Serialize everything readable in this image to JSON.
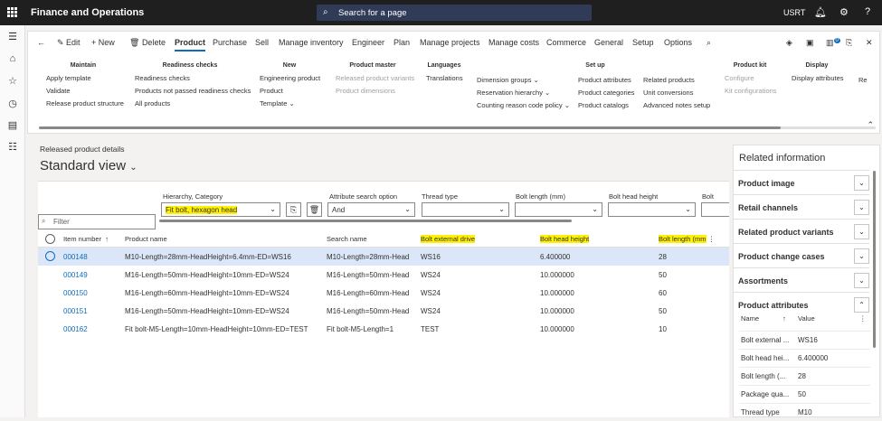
{
  "topbar": {
    "app_title": "Finance and Operations",
    "search_placeholder": "Search for a page",
    "company": "USRT"
  },
  "tabs": [
    {
      "label": "Edit"
    },
    {
      "label": "New"
    },
    {
      "label": "Delete"
    },
    {
      "label": "Product"
    },
    {
      "label": "Purchase"
    },
    {
      "label": "Sell"
    },
    {
      "label": "Manage inventory"
    },
    {
      "label": "Engineer"
    },
    {
      "label": "Plan"
    },
    {
      "label": "Manage projects"
    },
    {
      "label": "Manage costs"
    },
    {
      "label": "Commerce"
    },
    {
      "label": "General"
    },
    {
      "label": "Setup"
    },
    {
      "label": "Options"
    }
  ],
  "notification_count": "0",
  "groups": {
    "maintain": {
      "title": "Maintain",
      "items": [
        "Apply template",
        "Validate",
        "Release product structure"
      ]
    },
    "readiness": {
      "title": "Readiness checks",
      "items": [
        "Readiness checks",
        "Products not passed readiness checks",
        "All products"
      ]
    },
    "new": {
      "title": "New",
      "items": [
        "Engineering product",
        "Product",
        "Template"
      ]
    },
    "master": {
      "title": "Product master",
      "items": [
        "Released product variants",
        "Product dimensions"
      ]
    },
    "languages": {
      "title": "Languages",
      "items": [
        "Translations"
      ]
    },
    "setup_a": {
      "items": [
        "Dimension groups",
        "Reservation hierarchy",
        "Counting reason code policy"
      ]
    },
    "setup_title": "Set up",
    "setup_b": {
      "items": [
        "Product attributes",
        "Product categories",
        "Product catalogs"
      ]
    },
    "setup_c": {
      "items": [
        "Related products",
        "Unit conversions",
        "Advanced notes setup"
      ]
    },
    "kit": {
      "title": "Product kit",
      "items": [
        "Configure",
        "Kit configurations"
      ]
    },
    "display": {
      "title": "Display",
      "items": [
        "Display attributes"
      ]
    },
    "truncated": "Re"
  },
  "page": {
    "breadcrumb": "Released product details",
    "view_title": "Standard view"
  },
  "filters": {
    "hierarchy_label": "Hierarchy, Category",
    "hierarchy_value": "Fit bolt, hexagon head",
    "attr_search_label": "Attribute search option",
    "attr_search_value": "And",
    "thread_label": "Thread type",
    "bolt_length_label": "Bolt length (mm)",
    "bolt_head_label": "Bolt head height",
    "truncated_label": "Bolt",
    "filter_placeholder": "Filter"
  },
  "columns": [
    "Item number",
    "Product name",
    "Search name",
    "Bolt external drive",
    "Bolt head height",
    "Bolt length (mm"
  ],
  "rows": [
    {
      "item": "000148",
      "name": "M10-Length=28mm-HeadHeight=6.4mm-ED=WS16",
      "search": "M10-Length=28mm-Head",
      "drive": "WS16",
      "head": "6.400000",
      "length": "28"
    },
    {
      "item": "000149",
      "name": "M16-Length=50mm-HeadHeight=10mm-ED=WS24",
      "search": "M16-Length=50mm-Head",
      "drive": "WS24",
      "head": "10.000000",
      "length": "50"
    },
    {
      "item": "000150",
      "name": "M16-Length=60mm-HeadHeight=10mm-ED=WS24",
      "search": "M16-Length=60mm-Head",
      "drive": "WS24",
      "head": "10.000000",
      "length": "60"
    },
    {
      "item": "000151",
      "name": "M16-Length=50mm-HeadHeight=10mm-ED=WS24",
      "search": "M16-Length=50mm-Head",
      "drive": "WS24",
      "head": "10.000000",
      "length": "50"
    },
    {
      "item": "000162",
      "name": "Fit bolt-M5-Length=10mm-HeadHeight=10mm-ED=TEST",
      "search": "Fit bolt-M5-Length=1",
      "drive": "TEST",
      "head": "10.000000",
      "length": "10"
    }
  ],
  "related": {
    "title": "Related information",
    "sections": [
      "Product image",
      "Retail channels",
      "Related product variants",
      "Product change cases",
      "Assortments",
      "Product attributes"
    ],
    "attr_headers": [
      "Name",
      "Value"
    ],
    "attr_rows": [
      {
        "name": "Bolt external ...",
        "value": "WS16"
      },
      {
        "name": "Bolt head hei...",
        "value": "6.400000"
      },
      {
        "name": "Bolt length (...",
        "value": "28"
      },
      {
        "name": "Package qua...",
        "value": "50"
      },
      {
        "name": "Thread type",
        "value": "M10"
      }
    ]
  }
}
